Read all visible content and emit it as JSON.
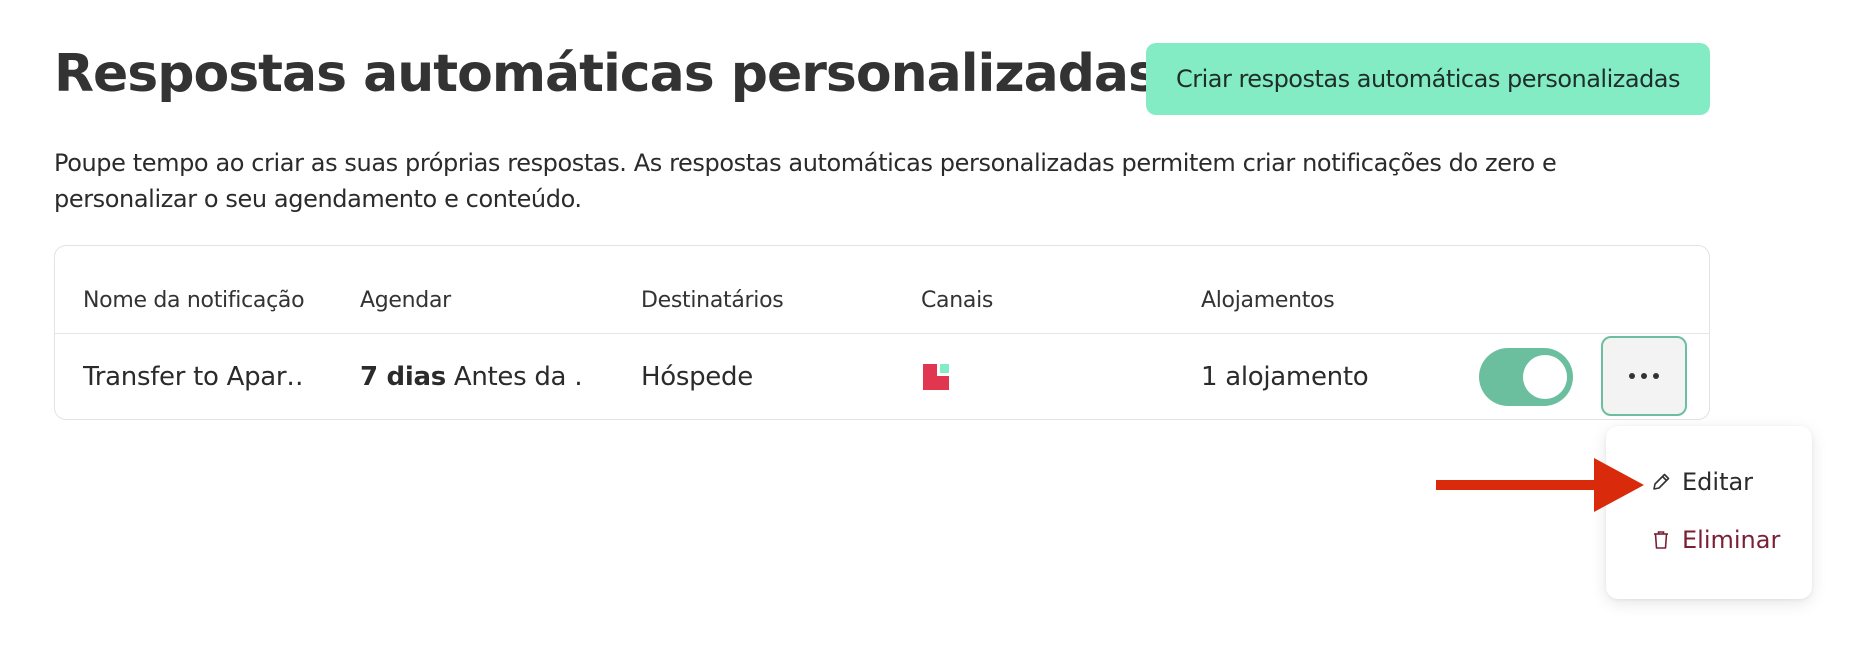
{
  "page": {
    "title": "Respostas automáticas personalizadas",
    "create_button_label": "Criar respostas automáticas personalizadas",
    "description": "Poupe tempo ao criar as suas próprias respostas. As respostas automáticas personalizadas permitem criar notificações do zero e personalizar o seu agendamento e conteúdo."
  },
  "table": {
    "columns": [
      "Nome da notificação",
      "Agendar",
      "Destinatários",
      "Canais",
      "Alojamentos"
    ],
    "rows": [
      {
        "name": "Transfer to Apar…",
        "schedule_bold": "7 dias",
        "schedule_rest": " Antes da …",
        "recipients": "Hóspede",
        "channel_icon": "airbnb-channel-icon",
        "properties": "1 alojamento",
        "enabled": true
      }
    ]
  },
  "menu": {
    "edit_label": "Editar",
    "delete_label": "Eliminar"
  },
  "colors": {
    "accent": "#84ecc4",
    "toggle_on": "#6cbf9e",
    "delete": "#7a1f35",
    "arrow": "#d92a0c",
    "channel_red": "#e0364f",
    "channel_teal": "#84ecc4"
  }
}
